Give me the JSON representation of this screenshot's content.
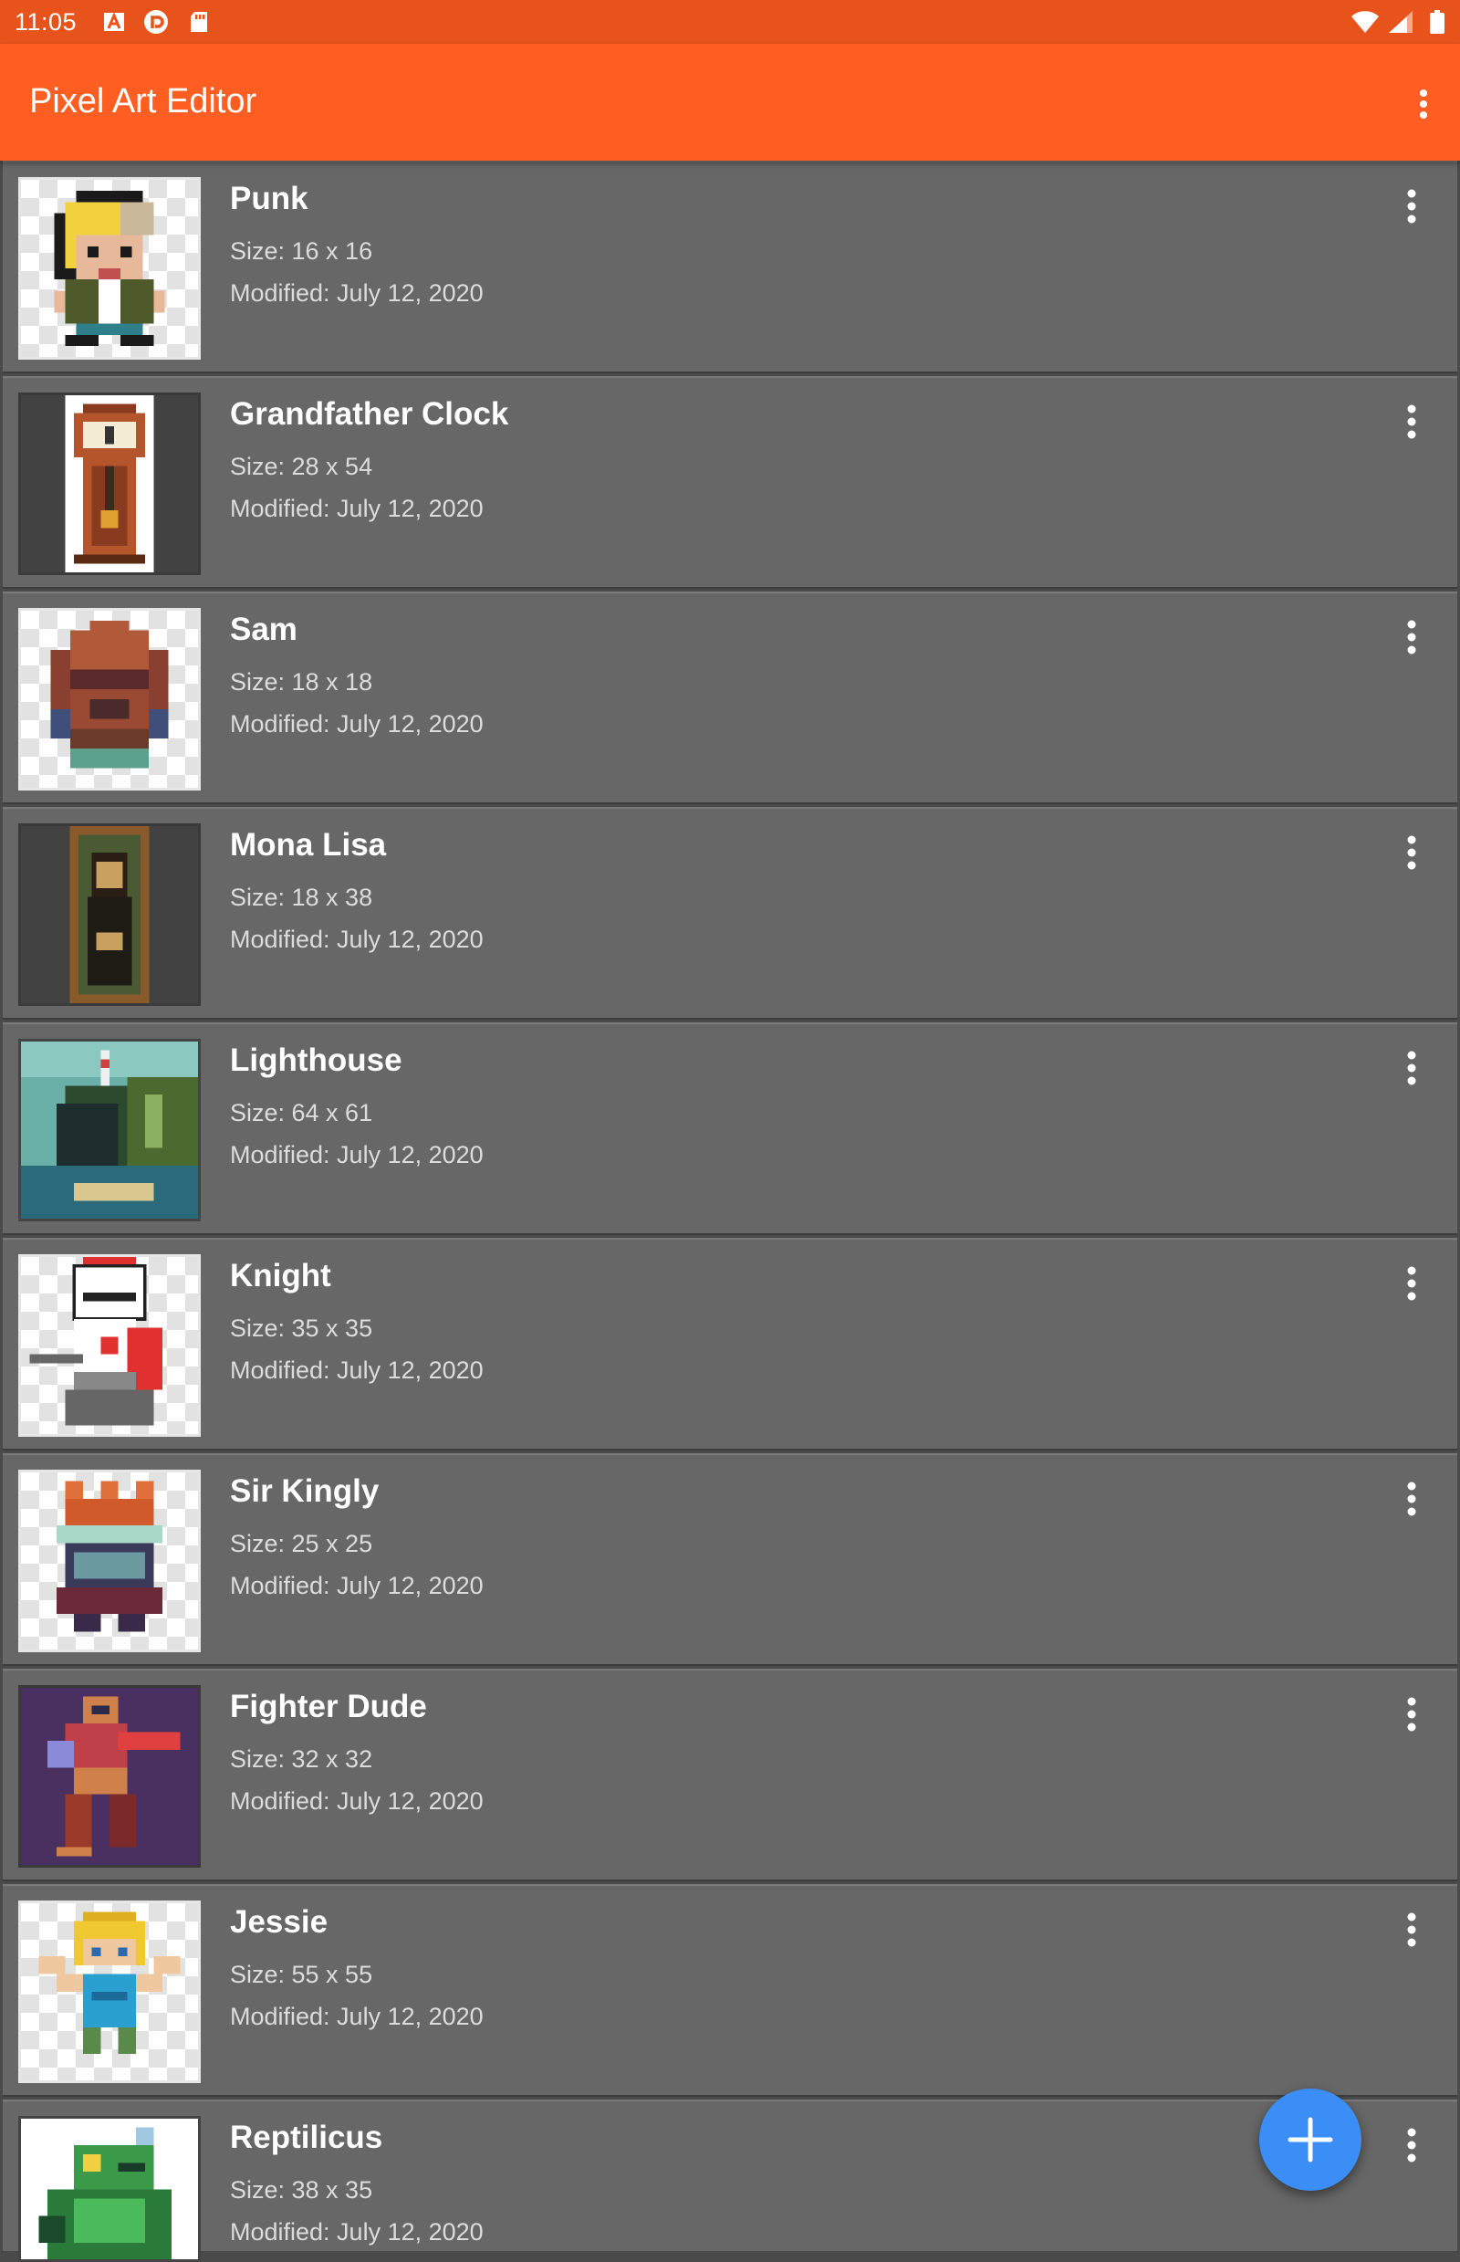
{
  "status": {
    "time": "11:05",
    "notifications": [
      "a-icon",
      "pocket-casts-icon",
      "sd-card-icon"
    ],
    "indicators": [
      "wifi-icon",
      "signal-icon",
      "battery-icon"
    ]
  },
  "app": {
    "title": "Pixel Art Editor",
    "menu_icon": "overflow-menu-icon"
  },
  "items": [
    {
      "title": "Punk",
      "size": "Size: 16 x 16",
      "modified": "Modified: July 12, 2020",
      "thumb_bg": "checker"
    },
    {
      "title": "Grandfather Clock",
      "size": "Size: 28 x 54",
      "modified": "Modified: July 12, 2020",
      "thumb_bg": "dark"
    },
    {
      "title": "Sam",
      "size": "Size: 18 x 18",
      "modified": "Modified: July 12, 2020",
      "thumb_bg": "checker"
    },
    {
      "title": "Mona Lisa",
      "size": "Size: 18 x 38",
      "modified": "Modified: July 12, 2020",
      "thumb_bg": "dark"
    },
    {
      "title": "Lighthouse",
      "size": "Size: 64 x 61",
      "modified": "Modified: July 12, 2020",
      "thumb_bg": "scene"
    },
    {
      "title": "Knight",
      "size": "Size: 35 x 35",
      "modified": "Modified: July 12, 2020",
      "thumb_bg": "checker"
    },
    {
      "title": "Sir Kingly",
      "size": "Size: 25 x 25",
      "modified": "Modified: July 12, 2020",
      "thumb_bg": "checker"
    },
    {
      "title": "Fighter Dude",
      "size": "Size: 32 x 32",
      "modified": "Modified: July 12, 2020",
      "thumb_bg": "purple"
    },
    {
      "title": "Jessie",
      "size": "Size: 55 x 55",
      "modified": "Modified: July 12, 2020",
      "thumb_bg": "checker"
    },
    {
      "title": "Reptilicus",
      "size": "Size: 38 x 35",
      "modified": "Modified: July 12, 2020",
      "thumb_bg": "white"
    }
  ],
  "fab": {
    "icon": "plus-icon"
  },
  "colors": {
    "status_bar": "#e8531c",
    "app_bar": "#ff5e23",
    "row": "#676767",
    "fab": "#3b8ef5"
  }
}
